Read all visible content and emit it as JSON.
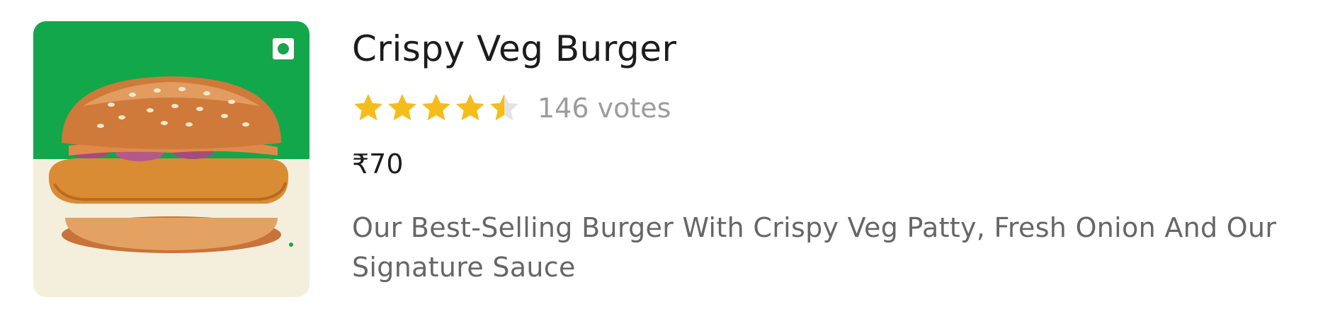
{
  "item": {
    "name": "Crispy Veg Burger",
    "rating": 4.5,
    "rating_max": 5,
    "votes_label": "146 votes",
    "price": "₹70",
    "description": "Our Best-Selling Burger With Crispy Veg Patty, Fresh Onion And Our Signature Sauce",
    "image_icon": "burger-photo",
    "diet_icon": "veg-indicator-icon"
  },
  "colors": {
    "star_filled": "#f5bd1b",
    "star_empty": "#e4e4e4",
    "image_bg_top": "#13a74b",
    "image_bg_bottom": "#f4efdc",
    "veg_green": "#1aa34a",
    "title_text": "#1c1c1c",
    "muted_text": "#9c9c9c",
    "desc_text": "#666666"
  }
}
